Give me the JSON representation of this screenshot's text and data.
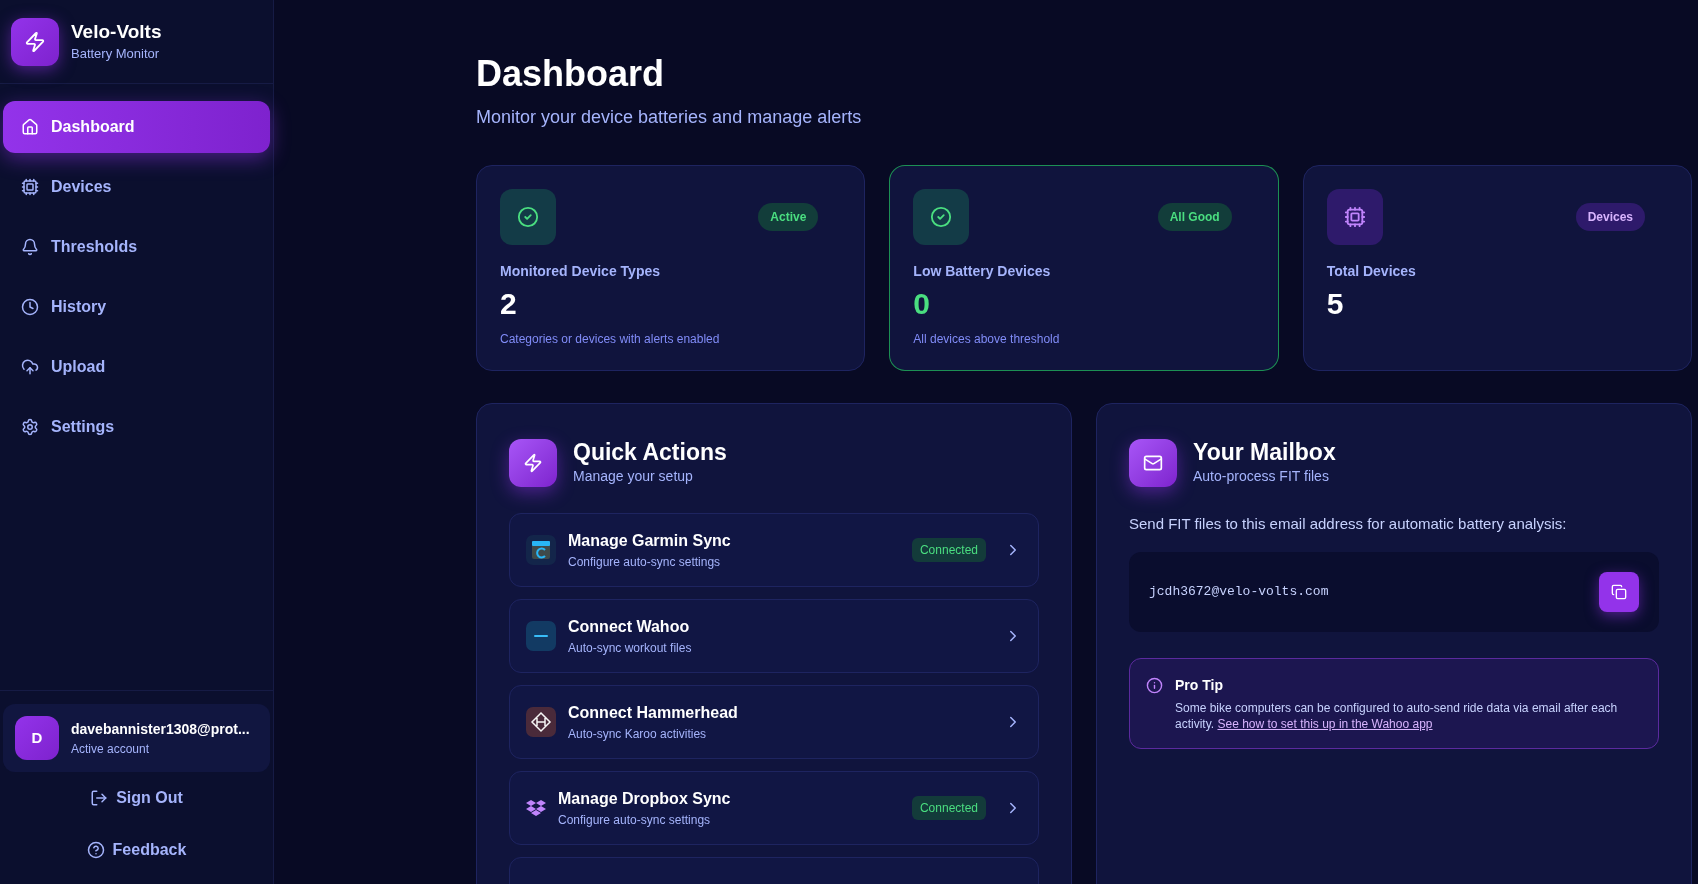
{
  "brand": {
    "name": "Velo-Volts",
    "tagline": "Battery Monitor"
  },
  "nav": [
    {
      "kind": "home",
      "label": "Dashboard",
      "selected": true
    },
    {
      "kind": "chip",
      "label": "Devices",
      "selected": false
    },
    {
      "kind": "bell",
      "label": "Thresholds",
      "selected": false
    },
    {
      "kind": "clock",
      "label": "History",
      "selected": false
    },
    {
      "kind": "upload",
      "label": "Upload",
      "selected": false
    },
    {
      "kind": "gear",
      "label": "Settings",
      "selected": false
    }
  ],
  "account": {
    "initial": "D",
    "email": "davebannister1308@prot...",
    "status": "Active account"
  },
  "footer_links": [
    {
      "kind": "signout",
      "label": "Sign Out"
    },
    {
      "kind": "help",
      "label": "Feedback"
    }
  ],
  "page": {
    "title": "Dashboard",
    "subtitle": "Monitor your device batteries and manage alerts"
  },
  "stats": [
    {
      "kind": "check",
      "badge": "Active",
      "label": "Monitored Device Types",
      "value": "2",
      "note": "Categories or devices with alerts enabled",
      "highlighted": false
    },
    {
      "kind": "check",
      "badge": "All Good",
      "label": "Low Battery Devices",
      "value": "0",
      "note": "All devices above threshold",
      "highlighted": true
    },
    {
      "kind": "chip",
      "badge": "Devices",
      "label": "Total Devices",
      "value": "5",
      "highlighted": false
    }
  ],
  "quick_actions": {
    "title": "Quick Actions",
    "subtitle": "Manage your setup",
    "items": [
      {
        "kind": "garmin",
        "title": "Manage Garmin Sync",
        "subtitle": "Configure auto-sync settings",
        "badge": "Connected"
      },
      {
        "kind": "wahoo",
        "title": "Connect Wahoo",
        "subtitle": "Auto-sync workout files"
      },
      {
        "kind": "hammerhead",
        "title": "Connect Hammerhead",
        "subtitle": "Auto-sync Karoo activities"
      },
      {
        "kind": "dropbox",
        "title": "Manage Dropbox Sync",
        "subtitle": "Configure auto-sync settings",
        "badge": "Connected"
      }
    ]
  },
  "mailbox": {
    "title": "Your Mailbox",
    "subtitle": "Auto-process FIT files",
    "intro": "Send FIT files to this email address for automatic battery analysis:",
    "address": "jcdh3672@velo-volts.com",
    "tip": {
      "title": "Pro Tip",
      "text": "Some bike computers can be configured to auto-send ride data via email after each activity.",
      "link": "See how to set this up in the Wahoo app"
    }
  }
}
